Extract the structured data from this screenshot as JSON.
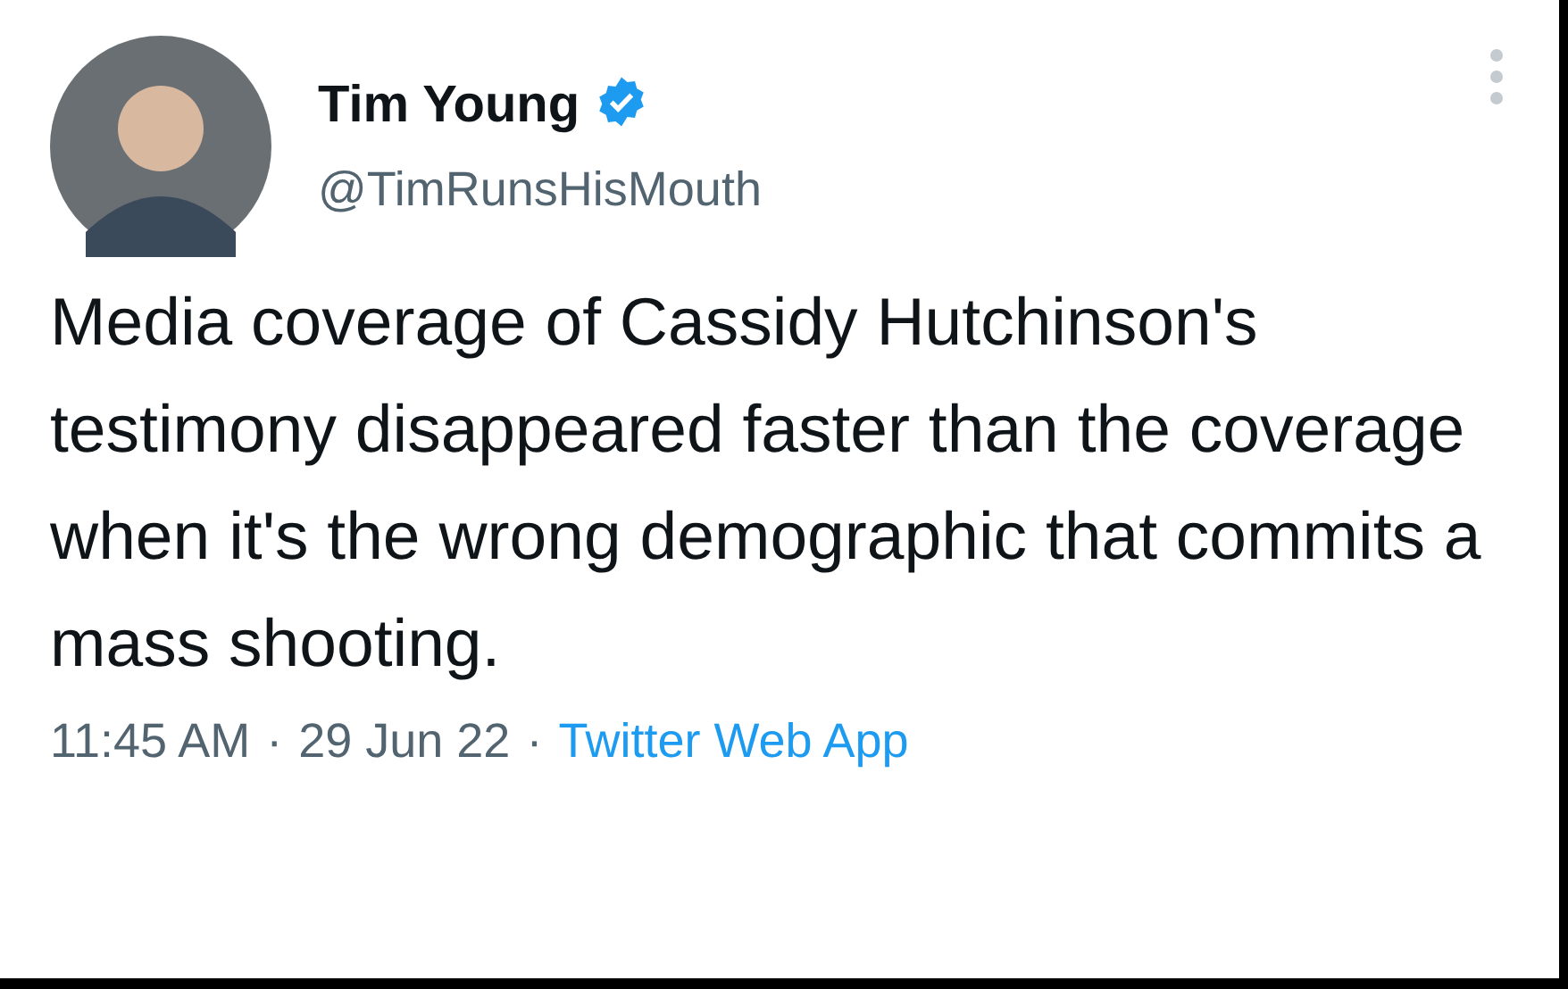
{
  "tweet": {
    "author": {
      "name": "Tim Young",
      "verified": true,
      "handle": "@TimRunsHisMouth"
    },
    "text": "Media coverage of Cassidy Hutchinson's testimony disappeared faster than the coverage when it's the wrong demographic that commits a mass shooting.",
    "meta": [
      {
        "kind": "plain",
        "text": "11:45 AM"
      },
      {
        "kind": "sep",
        "text": "·"
      },
      {
        "kind": "plain",
        "text": "29 Jun 22"
      },
      {
        "kind": "sep",
        "text": "·"
      },
      {
        "kind": "link",
        "text": "Twitter Web App"
      }
    ]
  }
}
